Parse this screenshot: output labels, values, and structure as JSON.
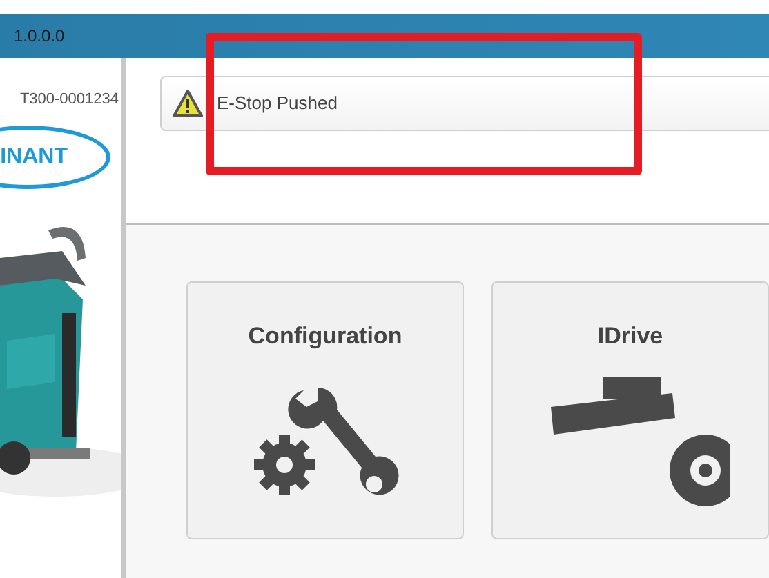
{
  "window": {
    "title": "1.0.0.0"
  },
  "machine": {
    "serial": "T300-0001234",
    "logo": "INANT"
  },
  "alert": {
    "kind": "warning",
    "message": "E-Stop Pushed"
  },
  "tiles": [
    {
      "label": "Configuration",
      "kind": "configuration"
    },
    {
      "label": "IDrive",
      "kind": "idrive"
    }
  ]
}
